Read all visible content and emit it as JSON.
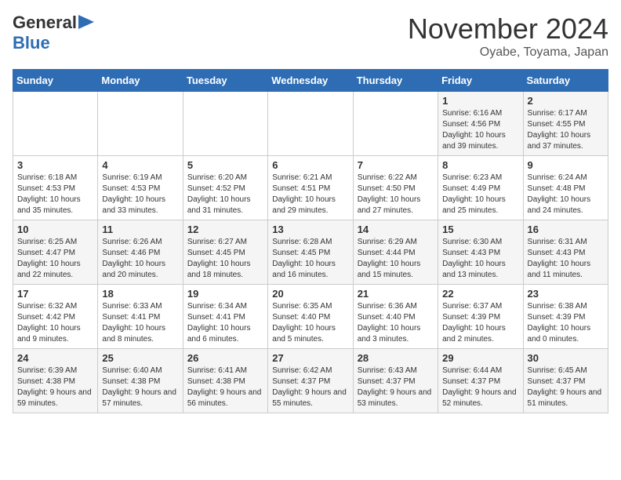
{
  "header": {
    "logo_line1": "General",
    "logo_line2": "Blue",
    "month": "November 2024",
    "location": "Oyabe, Toyama, Japan"
  },
  "days_of_week": [
    "Sunday",
    "Monday",
    "Tuesday",
    "Wednesday",
    "Thursday",
    "Friday",
    "Saturday"
  ],
  "weeks": [
    [
      {
        "day": "",
        "info": ""
      },
      {
        "day": "",
        "info": ""
      },
      {
        "day": "",
        "info": ""
      },
      {
        "day": "",
        "info": ""
      },
      {
        "day": "",
        "info": ""
      },
      {
        "day": "1",
        "info": "Sunrise: 6:16 AM\nSunset: 4:56 PM\nDaylight: 10 hours and 39 minutes."
      },
      {
        "day": "2",
        "info": "Sunrise: 6:17 AM\nSunset: 4:55 PM\nDaylight: 10 hours and 37 minutes."
      }
    ],
    [
      {
        "day": "3",
        "info": "Sunrise: 6:18 AM\nSunset: 4:53 PM\nDaylight: 10 hours and 35 minutes."
      },
      {
        "day": "4",
        "info": "Sunrise: 6:19 AM\nSunset: 4:53 PM\nDaylight: 10 hours and 33 minutes."
      },
      {
        "day": "5",
        "info": "Sunrise: 6:20 AM\nSunset: 4:52 PM\nDaylight: 10 hours and 31 minutes."
      },
      {
        "day": "6",
        "info": "Sunrise: 6:21 AM\nSunset: 4:51 PM\nDaylight: 10 hours and 29 minutes."
      },
      {
        "day": "7",
        "info": "Sunrise: 6:22 AM\nSunset: 4:50 PM\nDaylight: 10 hours and 27 minutes."
      },
      {
        "day": "8",
        "info": "Sunrise: 6:23 AM\nSunset: 4:49 PM\nDaylight: 10 hours and 25 minutes."
      },
      {
        "day": "9",
        "info": "Sunrise: 6:24 AM\nSunset: 4:48 PM\nDaylight: 10 hours and 24 minutes."
      }
    ],
    [
      {
        "day": "10",
        "info": "Sunrise: 6:25 AM\nSunset: 4:47 PM\nDaylight: 10 hours and 22 minutes."
      },
      {
        "day": "11",
        "info": "Sunrise: 6:26 AM\nSunset: 4:46 PM\nDaylight: 10 hours and 20 minutes."
      },
      {
        "day": "12",
        "info": "Sunrise: 6:27 AM\nSunset: 4:45 PM\nDaylight: 10 hours and 18 minutes."
      },
      {
        "day": "13",
        "info": "Sunrise: 6:28 AM\nSunset: 4:45 PM\nDaylight: 10 hours and 16 minutes."
      },
      {
        "day": "14",
        "info": "Sunrise: 6:29 AM\nSunset: 4:44 PM\nDaylight: 10 hours and 15 minutes."
      },
      {
        "day": "15",
        "info": "Sunrise: 6:30 AM\nSunset: 4:43 PM\nDaylight: 10 hours and 13 minutes."
      },
      {
        "day": "16",
        "info": "Sunrise: 6:31 AM\nSunset: 4:43 PM\nDaylight: 10 hours and 11 minutes."
      }
    ],
    [
      {
        "day": "17",
        "info": "Sunrise: 6:32 AM\nSunset: 4:42 PM\nDaylight: 10 hours and 9 minutes."
      },
      {
        "day": "18",
        "info": "Sunrise: 6:33 AM\nSunset: 4:41 PM\nDaylight: 10 hours and 8 minutes."
      },
      {
        "day": "19",
        "info": "Sunrise: 6:34 AM\nSunset: 4:41 PM\nDaylight: 10 hours and 6 minutes."
      },
      {
        "day": "20",
        "info": "Sunrise: 6:35 AM\nSunset: 4:40 PM\nDaylight: 10 hours and 5 minutes."
      },
      {
        "day": "21",
        "info": "Sunrise: 6:36 AM\nSunset: 4:40 PM\nDaylight: 10 hours and 3 minutes."
      },
      {
        "day": "22",
        "info": "Sunrise: 6:37 AM\nSunset: 4:39 PM\nDaylight: 10 hours and 2 minutes."
      },
      {
        "day": "23",
        "info": "Sunrise: 6:38 AM\nSunset: 4:39 PM\nDaylight: 10 hours and 0 minutes."
      }
    ],
    [
      {
        "day": "24",
        "info": "Sunrise: 6:39 AM\nSunset: 4:38 PM\nDaylight: 9 hours and 59 minutes."
      },
      {
        "day": "25",
        "info": "Sunrise: 6:40 AM\nSunset: 4:38 PM\nDaylight: 9 hours and 57 minutes."
      },
      {
        "day": "26",
        "info": "Sunrise: 6:41 AM\nSunset: 4:38 PM\nDaylight: 9 hours and 56 minutes."
      },
      {
        "day": "27",
        "info": "Sunrise: 6:42 AM\nSunset: 4:37 PM\nDaylight: 9 hours and 55 minutes."
      },
      {
        "day": "28",
        "info": "Sunrise: 6:43 AM\nSunset: 4:37 PM\nDaylight: 9 hours and 53 minutes."
      },
      {
        "day": "29",
        "info": "Sunrise: 6:44 AM\nSunset: 4:37 PM\nDaylight: 9 hours and 52 minutes."
      },
      {
        "day": "30",
        "info": "Sunrise: 6:45 AM\nSunset: 4:37 PM\nDaylight: 9 hours and 51 minutes."
      }
    ]
  ]
}
